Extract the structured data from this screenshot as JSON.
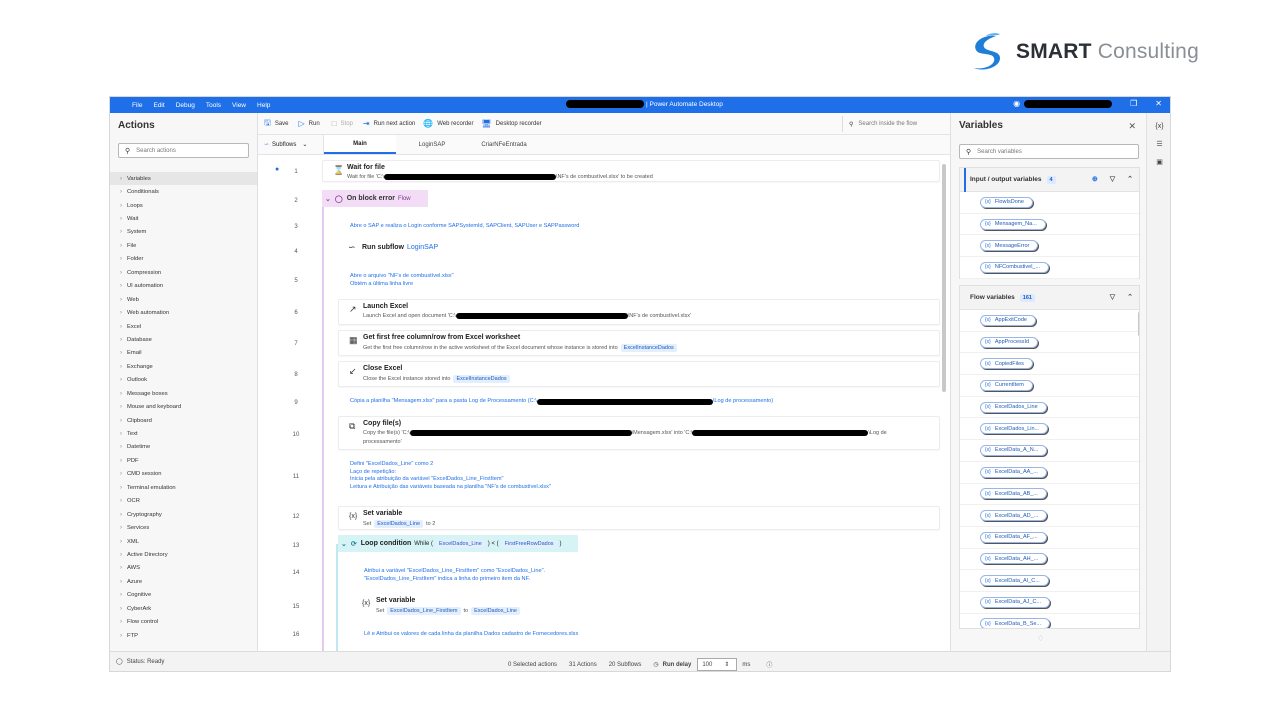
{
  "logo": {
    "brand_bold": "SMART",
    "brand_light": "Consulting"
  },
  "titlebar": {
    "menu": [
      "File",
      "Edit",
      "Debug",
      "Tools",
      "View",
      "Help"
    ],
    "title": "| Power Automate Desktop"
  },
  "toolbar": {
    "save": "Save",
    "run": "Run",
    "stop": "Stop",
    "run_next": "Run next action",
    "web_recorder": "Web recorder",
    "desktop_recorder": "Desktop recorder",
    "search_placeholder": "Search inside the flow"
  },
  "tabs": {
    "subflows": "Subflows",
    "items": [
      "Main",
      "LoginSAP",
      "CriarNFeEntrada"
    ]
  },
  "actions_panel": {
    "title": "Actions",
    "search_placeholder": "Search actions",
    "items": [
      "Variables",
      "Conditionals",
      "Loops",
      "Wait",
      "System",
      "File",
      "Folder",
      "Compression",
      "UI automation",
      "Web",
      "Web automation",
      "Excel",
      "Database",
      "Email",
      "Exchange",
      "Outlook",
      "Message boxes",
      "Mouse and keyboard",
      "Clipboard",
      "Text",
      "Datetime",
      "PDF",
      "CMD session",
      "Terminal emulation",
      "OCR",
      "Cryptography",
      "Services",
      "XML",
      "Active Directory",
      "AWS",
      "Azure",
      "Cognitive",
      "CyberArk",
      "Flow control",
      "FTP"
    ]
  },
  "flow": {
    "lines": [
      "1",
      "2",
      "3",
      "4",
      "5",
      "6",
      "7",
      "8",
      "9",
      "10",
      "11",
      "12",
      "13",
      "14",
      "15",
      "16"
    ],
    "wait_title": "Wait for file",
    "wait_prefix": "Wait for file 'C:\\",
    "wait_suffix": "\\NF's de combustível.xlsx' to be created",
    "on_block_error": "On block error",
    "on_block_flow": "Flow",
    "comment3": "Abre o SAP e realiza o Login conforme SAPSystemId, SAPClient, SAPUser e SAPPassword",
    "run_subflow": "Run subflow",
    "run_subflow_target": "LoginSAP",
    "comment5a": "Abre o arquivo \"NF's de combustível.xlsx\"",
    "comment5b": "Obtém a última linha livre",
    "launch_title": "Launch Excel",
    "launch_prefix": "Launch Excel and open document 'C:\\",
    "launch_suffix": "\\NF's de combustível.xlsx'",
    "getfree_title": "Get first free column/row from Excel worksheet",
    "getfree_desc": "Get the first free column/row in the active worksheet of the Excel document whose instance is stored into",
    "getfree_chip": "ExcelInstanceDados",
    "close_title": "Close Excel",
    "close_desc": "Close the Excel instance stored into",
    "close_chip": "ExcelInstanceDados",
    "comment9_prefix": "Cópia a planilha \"Mensagem.xlsx\" para a pasta Log de Processamento (C:\\",
    "comment9_suffix": "\\Log de processamento)",
    "copy_title": "Copy file(s)",
    "copy_prefix": "Copy the file(s) 'C:\\",
    "copy_mid": "\\Mensagem.xlsx' into 'C:\\",
    "copy_suffix": "\\Log de",
    "copy_suffix2": "processamento'",
    "comment11a": "Defini \"ExcelDados_Line\" como 2",
    "comment11b": "Laço de repetição:",
    "comment11c": "Inicia pela atribuição da variável \"ExcelDados_Line_FirstItem\"",
    "comment11d": "Leitura e Atribuição das variáveis baseada na planilha \"NF's de combustível.xlsx\"",
    "setvar_title": "Set variable",
    "setvar_set": "Set",
    "setvar_chip": "ExcelDados_Line",
    "setvar_to": "to 2",
    "loop_title": "Loop condition",
    "loop_while": "While (",
    "loop_chip1": "ExcelDados_Line",
    "loop_op": ") < (",
    "loop_chip2": "FirstFreeRowDados",
    "loop_close": ")",
    "comment14a": "Atribui a variável \"ExcelDados_Line_FirstItem\" como \"ExcelDados_Line\".",
    "comment14b": "\"ExcelDados_Line_FirstItem\" indica a linha do primeiro item da NF.",
    "setvar2_title": "Set variable",
    "setvar2_set": "Set",
    "setvar2_chip": "ExcelDados_Line_FirstItem",
    "setvar2_to": "to",
    "setvar2_chip2": "ExcelDados_Line",
    "comment16": "Lê e Atribui os valores de cada linha da planilha Dados cadastro de Fornecedores.xlsx"
  },
  "variables_panel": {
    "title": "Variables",
    "search_placeholder": "Search variables",
    "io_title": "Input / output variables",
    "io_count": "4",
    "io_vars": [
      "FlowIsDone",
      "Mensagem_Na...",
      "MessageError",
      "NFCombustivel_..."
    ],
    "flow_title": "Flow variables",
    "flow_count": "161",
    "flow_vars": [
      "AppExitCode",
      "AppProcessId",
      "CopiedFiles",
      "CurrentItem",
      "ExcelDados_Line",
      "ExcelDados_Lin...",
      "ExcelData_A_N...",
      "ExcelData_AA_...",
      "ExcelData_AB_...",
      "ExcelData_AD_...",
      "ExcelData_AF_...",
      "ExcelData_AH_...",
      "ExcelData_AI_C...",
      "ExcelData_AJ_C...",
      "ExcelData_B_Se..."
    ]
  },
  "statusbar": {
    "status": "Status: Ready",
    "selected": "0 Selected actions",
    "actions": "31 Actions",
    "subflows": "20 Subflows",
    "run_delay": "Run delay",
    "delay_value": "100",
    "unit": "ms"
  }
}
